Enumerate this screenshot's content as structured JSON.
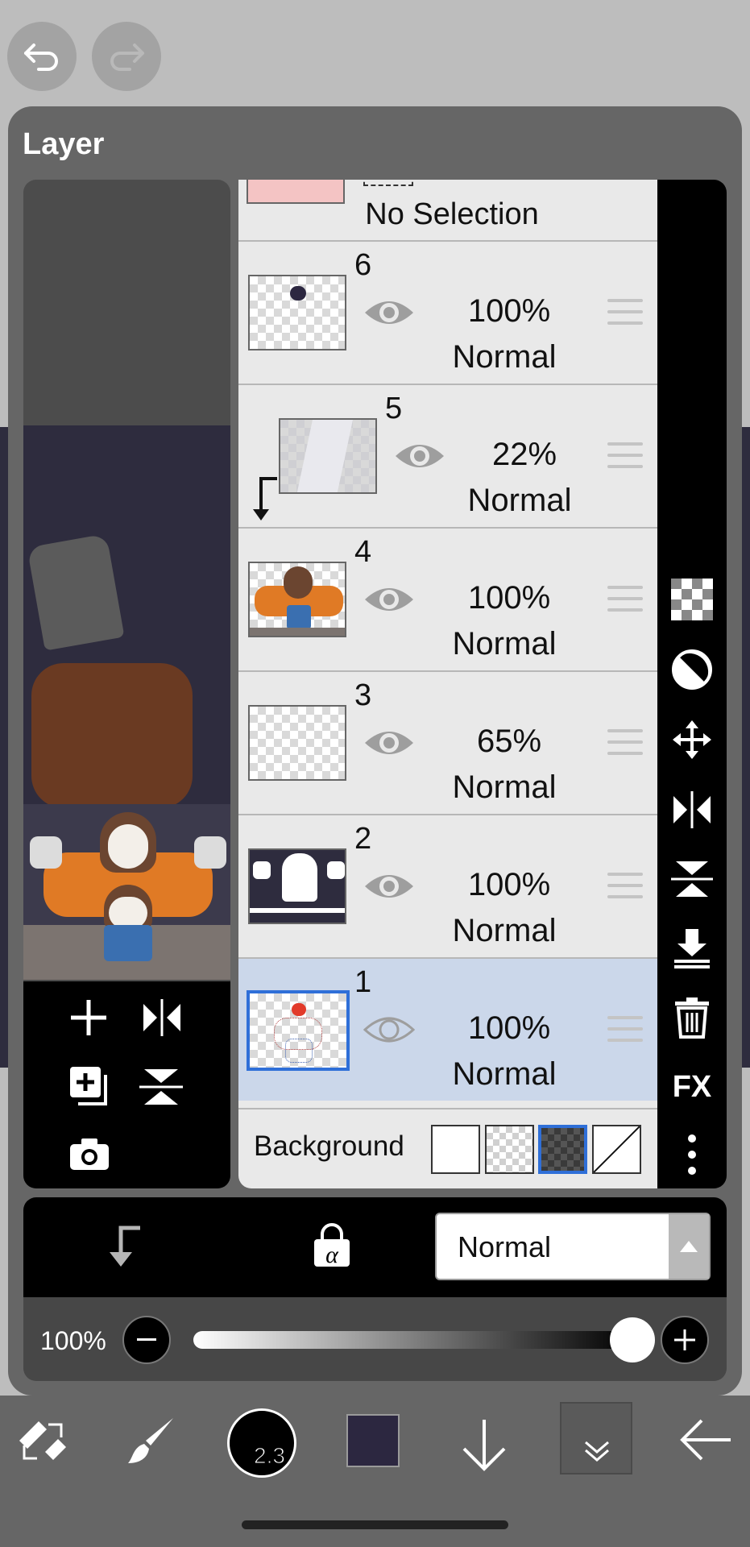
{
  "panel": {
    "title": "Layer"
  },
  "layers": [
    {
      "num": "6",
      "opacity": "100%",
      "mode": "Normal"
    },
    {
      "num": "5",
      "opacity": "22%",
      "mode": "Normal"
    },
    {
      "num": "4",
      "opacity": "100%",
      "mode": "Normal"
    },
    {
      "num": "3",
      "opacity": "65%",
      "mode": "Normal"
    },
    {
      "num": "2",
      "opacity": "100%",
      "mode": "Normal"
    },
    {
      "num": "1",
      "opacity": "100%",
      "mode": "Normal"
    }
  ],
  "selection_layer": {
    "label": "No Selection"
  },
  "background": {
    "label": "Background"
  },
  "blend": {
    "mode": "Normal"
  },
  "opacity": {
    "label": "100%",
    "value": 1.0
  },
  "brush": {
    "size": "2.3"
  },
  "colors": {
    "primary": "#2c2740"
  },
  "icons": {
    "undo": "undo-icon",
    "redo": "redo-icon",
    "side": [
      "checker-icon",
      "contrast-icon",
      "move-icon",
      "flip-horizontal-icon",
      "flip-vertical-icon",
      "merge-down-icon",
      "trash-icon",
      "fx-icon",
      "more-icon"
    ],
    "left_tools": [
      "add-layer-icon",
      "flip-horizontal-icon",
      "duplicate-layer-icon",
      "flip-vertical-icon",
      "camera-icon"
    ]
  },
  "side_fx_label": "FX"
}
